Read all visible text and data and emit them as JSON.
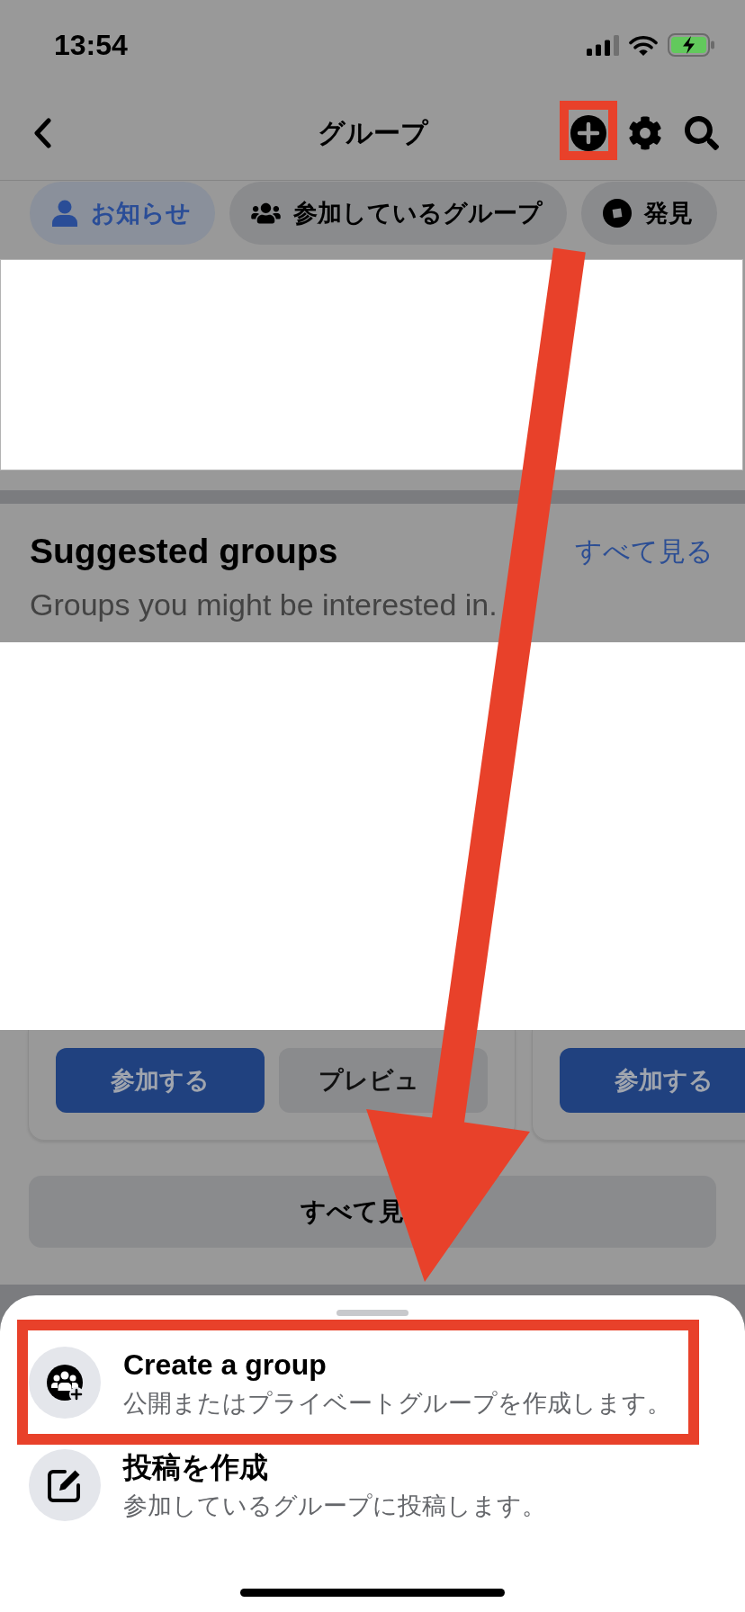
{
  "status_bar": {
    "time": "13:54"
  },
  "nav_bar": {
    "title": "グループ",
    "actions": [
      {
        "kind": "create",
        "highlighted": true
      },
      {
        "kind": "settings",
        "highlighted": false
      },
      {
        "kind": "search",
        "highlighted": false
      }
    ]
  },
  "tabs": [
    {
      "label": "お知らせ",
      "selected": true
    },
    {
      "label": "参加しているグループ",
      "selected": false
    },
    {
      "label": "発見",
      "selected": false
    }
  ],
  "suggested_groups": {
    "title": "Suggested groups",
    "subtitle": "Groups you might be interested in.",
    "see_all_link": "すべて見る",
    "cards": [
      {
        "buttons": [
          {
            "label": "参加する",
            "kind": "primary"
          },
          {
            "label": "プレビュ",
            "kind": "secondary"
          }
        ]
      },
      {
        "buttons": [
          {
            "label": "参加する",
            "kind": "primary"
          }
        ]
      }
    ],
    "see_all_button": "すべて見"
  },
  "sheet": {
    "items": [
      {
        "kind": "create_group",
        "title": "Create a group",
        "subtitle": "公開またはプライベートグループを作成します。",
        "highlighted": true
      },
      {
        "kind": "create_post",
        "title": "投稿を作成",
        "subtitle": "参加しているグループに投稿します。",
        "highlighted": false
      }
    ]
  }
}
